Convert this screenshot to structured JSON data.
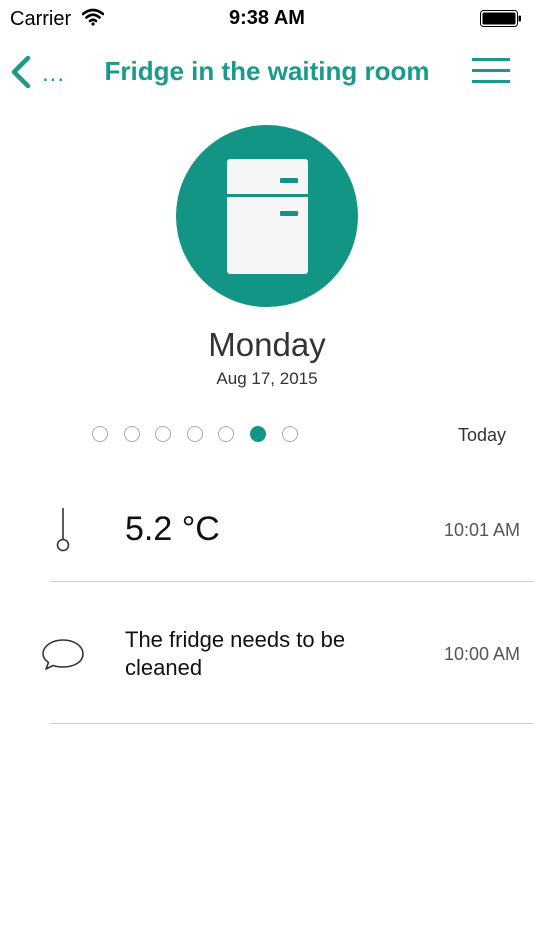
{
  "status_bar": {
    "carrier": "Carrier",
    "time": "9:38 AM"
  },
  "nav": {
    "back_label": "...",
    "title": "Fridge in the waiting room"
  },
  "device": {
    "icon": "fridge-icon",
    "day": "Monday",
    "date": "Aug 17, 2015"
  },
  "pager": {
    "count": 7,
    "active_index": 5,
    "today_label": "Today"
  },
  "log": [
    {
      "icon": "thermometer-icon",
      "text": "5.2 °C",
      "time": "10:01 AM"
    },
    {
      "icon": "speech-bubble-icon",
      "text": "The fridge needs to be cleaned",
      "time": "10:00 AM"
    }
  ],
  "colors": {
    "accent": "#129585",
    "title_text": "#1a9a8a"
  }
}
